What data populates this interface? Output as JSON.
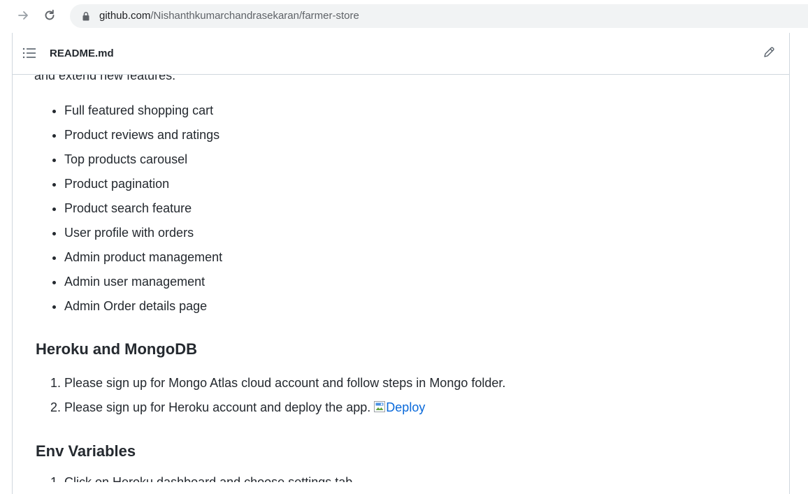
{
  "browser": {
    "url_domain": "github.com",
    "url_path": "/Nishanthkumarchandrasekaran/farmer-store"
  },
  "readme": {
    "title": "README.md",
    "cut_text": "and extend new features.",
    "features": [
      "Full featured shopping cart",
      "Product reviews and ratings",
      "Top products carousel",
      "Product pagination",
      "Product search feature",
      "User profile with orders",
      "Admin product management",
      "Admin user management",
      "Admin Order details page"
    ],
    "heroku_heading": "Heroku and MongoDB",
    "heroku_steps": {
      "step1": "Please sign up for Mongo Atlas cloud account and follow steps in Mongo folder.",
      "step2_text": "Please sign up for Heroku account and deploy the app. ",
      "step2_link": "Deploy"
    },
    "env_heading": "Env Variables",
    "env_steps": [
      "Click on Heroku dashboard and choose settings tab"
    ]
  },
  "icons": {
    "forward": "arrow-right-icon",
    "reload": "reload-icon",
    "lock": "lock-icon",
    "toc": "list-icon",
    "edit": "pencil-icon",
    "broken_image": "broken-image-icon"
  },
  "colors": {
    "link": "#0969da",
    "text": "#24292f",
    "border": "#d0d7de",
    "omnibox": "#f1f3f4"
  }
}
